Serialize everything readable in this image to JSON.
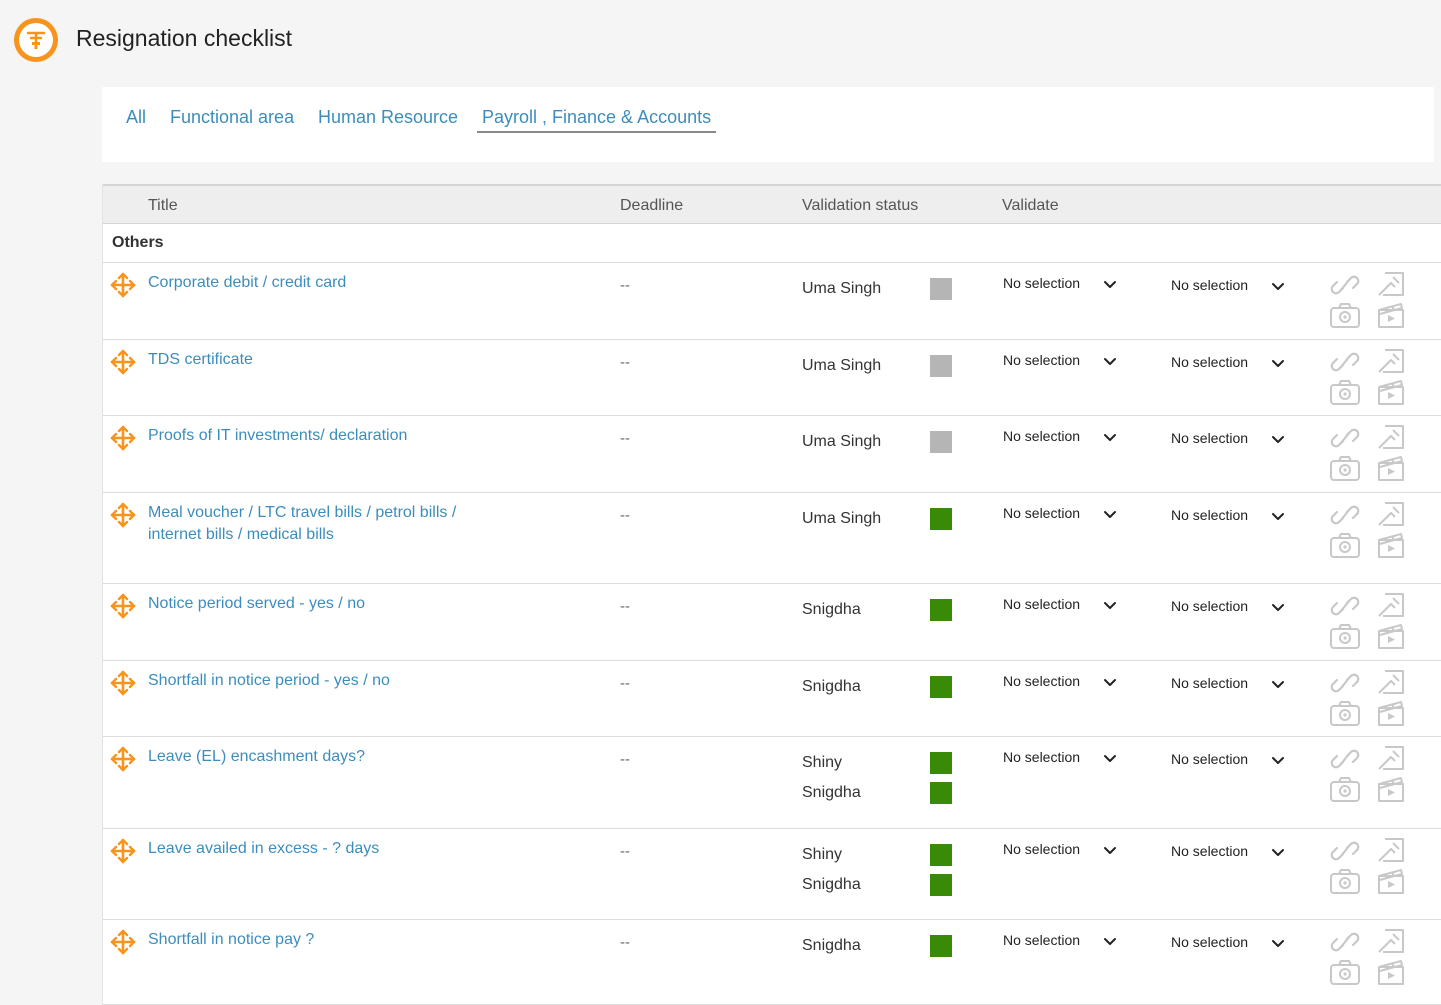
{
  "header": {
    "title": "Resignation checklist",
    "logo_icon": "checklist-logo-icon"
  },
  "tabs": [
    {
      "label": "All",
      "active": false
    },
    {
      "label": "Functional area",
      "active": false
    },
    {
      "label": "Human Resource",
      "active": false
    },
    {
      "label": "Payroll , Finance & Accounts",
      "active": true
    }
  ],
  "table": {
    "columns": {
      "title": "Title",
      "deadline": "Deadline",
      "validation_status": "Validation status",
      "validate": "Validate"
    },
    "group": "Others",
    "rows": [
      {
        "title": "Corporate debit / credit card",
        "deadline": "--",
        "validators": [
          {
            "name": "Uma Singh",
            "status_color": "#b5b5b5"
          }
        ],
        "validate_1": "No selection",
        "validate_2": "No selection"
      },
      {
        "title": "TDS certificate",
        "deadline": "--",
        "validators": [
          {
            "name": "Uma Singh",
            "status_color": "#b5b5b5"
          }
        ],
        "validate_1": "No selection",
        "validate_2": "No selection"
      },
      {
        "title": "Proofs of IT investments/ declaration",
        "deadline": "--",
        "validators": [
          {
            "name": "Uma Singh",
            "status_color": "#b5b5b5"
          }
        ],
        "validate_1": "No selection",
        "validate_2": "No selection"
      },
      {
        "title": "Meal voucher / LTC travel bills / petrol bills / internet bills / medical bills",
        "deadline": "--",
        "validators": [
          {
            "name": "Uma Singh",
            "status_color": "#3a8a0a"
          }
        ],
        "validate_1": "No selection",
        "validate_2": "No selection"
      },
      {
        "title": "Notice period served - yes / no",
        "deadline": "--",
        "validators": [
          {
            "name": "Snigdha",
            "status_color": "#3a8a0a"
          }
        ],
        "validate_1": "No selection",
        "validate_2": "No selection"
      },
      {
        "title": "Shortfall in notice period - yes / no",
        "deadline": "--",
        "validators": [
          {
            "name": "Snigdha",
            "status_color": "#3a8a0a"
          }
        ],
        "validate_1": "No selection",
        "validate_2": "No selection"
      },
      {
        "title": "Leave (EL) encashment days?",
        "deadline": "--",
        "validators": [
          {
            "name": "Shiny",
            "status_color": "#3a8a0a"
          },
          {
            "name": "Snigdha",
            "status_color": "#3a8a0a"
          }
        ],
        "validate_1": "No selection",
        "validate_2": "No selection"
      },
      {
        "title": "Leave availed in excess - ? days",
        "deadline": "--",
        "validators": [
          {
            "name": "Shiny",
            "status_color": "#3a8a0a"
          },
          {
            "name": "Snigdha",
            "status_color": "#3a8a0a"
          }
        ],
        "validate_1": "No selection",
        "validate_2": "No selection"
      },
      {
        "title": "Shortfall in notice pay ?",
        "deadline": "--",
        "validators": [
          {
            "name": "Snigdha",
            "status_color": "#3a8a0a"
          }
        ],
        "validate_1": "No selection",
        "validate_2": "No selection"
      }
    ]
  },
  "colors": {
    "accent": "#3c8dbc",
    "brand": "#f7941d",
    "status_done": "#3a8a0a",
    "status_pending": "#b5b5b5"
  }
}
